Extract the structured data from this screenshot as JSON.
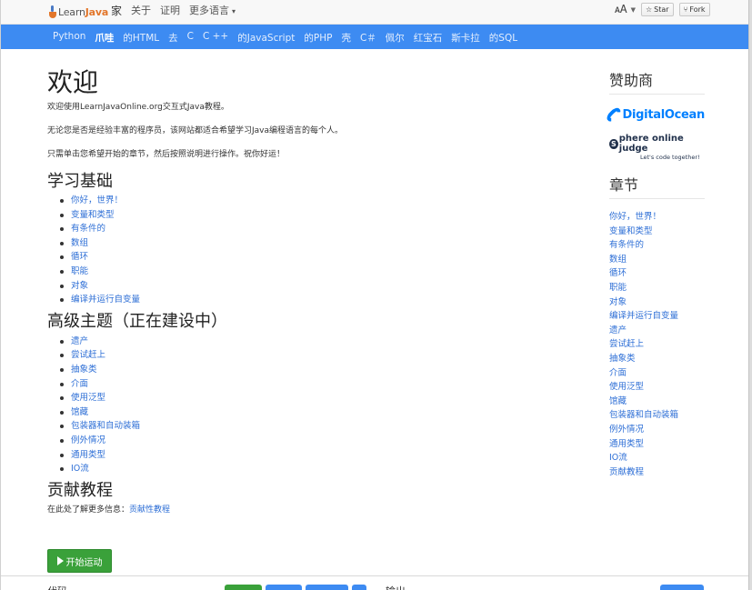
{
  "brand": {
    "learn": "Learn",
    "java": "Java"
  },
  "topnav": {
    "home": "家",
    "about": "关于",
    "certificates": "证明",
    "more_languages": "更多语言",
    "caret": "▾"
  },
  "github": {
    "star": "Star",
    "fork": "Fork",
    "lang_icon": "translate-icon"
  },
  "langbar": [
    "Python",
    "爪哇",
    "的HTML",
    "去",
    "C",
    "C ++",
    "的JavaScript",
    "的PHP",
    "壳",
    "C＃",
    "佩尔",
    "红宝石",
    "斯卡拉",
    "的SQL"
  ],
  "langbar_active_index": 1,
  "main": {
    "title": "欢迎",
    "intro1": "欢迎使用LearnJavaOnline.org交互式Java教程。",
    "intro2": "无论您是否是经验丰富的程序员，该网站都适合希望学习Java编程语言的每个人。",
    "intro3": "只需单击您希望开始的章节，然后按照说明进行操作。祝你好运！",
    "basics_heading": "学习基础",
    "basics": [
      "你好，世界！",
      "变量和类型",
      "有条件的",
      "数组",
      "循环",
      "职能",
      "对象",
      "编译并运行自变量"
    ],
    "advanced_heading": "高级主题（正在建设中）",
    "advanced": [
      "遗产",
      "尝试赶上",
      "抽象类",
      "介面",
      "使用泛型",
      "馆藏",
      "包装器和自动装箱",
      "例外情况",
      "通用类型",
      "IO流"
    ],
    "contrib_heading": "贡献教程",
    "contrib_text": "在此处了解更多信息：",
    "contrib_link": "贡献性教程",
    "start_button": "开始运动"
  },
  "sidebar": {
    "sponsors_heading": "赞助商",
    "sponsor1": "DigitalOcean",
    "sponsor2_s": "S",
    "sponsor2_title": "phere online judge",
    "sponsor2_tag": "Let's code together!",
    "chapters_heading": "章节",
    "chapters": [
      "你好，世界！",
      "变量和类型",
      "有条件的",
      "数组",
      "循环",
      "职能",
      "对象",
      "编译并运行自变量",
      "遗产",
      "尝试赶上",
      "抽象类",
      "介面",
      "使用泛型",
      "馆藏",
      "包装器和自动装箱",
      "例外情况",
      "通用类型",
      "IO流",
      "贡献教程"
    ]
  },
  "bottom": {
    "code_label": "代码",
    "output_label": "输出"
  },
  "colors": {
    "langbar": "#3d8bf2",
    "link": "#2e6fd6",
    "start": "#3aa13a",
    "digitalocean": "#0080ff"
  }
}
